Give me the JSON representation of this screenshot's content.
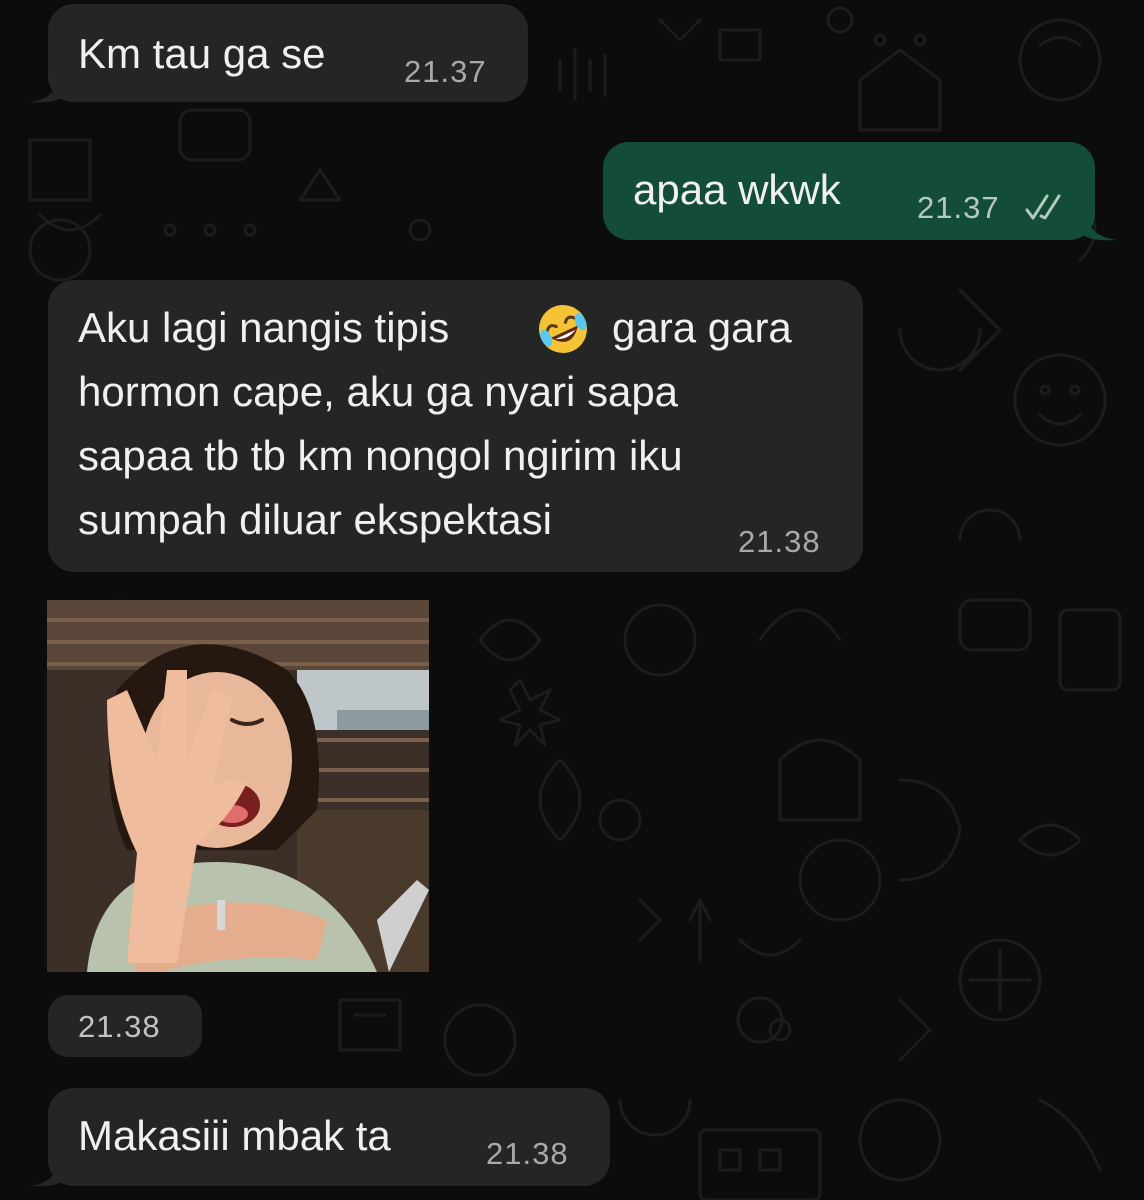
{
  "chat": {
    "messages": [
      {
        "id": "m1",
        "direction": "incoming",
        "text": "Km tau ga se",
        "time": "21.37"
      },
      {
        "id": "m2",
        "direction": "outgoing",
        "text": "apaa wkwk",
        "time": "21.37",
        "status": "read",
        "status_icon": "double-check-icon"
      },
      {
        "id": "m3",
        "direction": "incoming",
        "lines": [
          "Aku lagi nangis tipis",
          "gara gara",
          "hormon cape, aku ga nyari sapa",
          "sapaa tb tb km nongol ngirim iku",
          "sumpah diluar ekspektasi"
        ],
        "emoji": "🤣",
        "time": "21.38"
      },
      {
        "id": "m4",
        "direction": "incoming",
        "type": "image",
        "image_description_icon": "photo-girl-facepalm-laughing",
        "time": "21.38"
      },
      {
        "id": "m5",
        "direction": "incoming",
        "text": "Makasiii mbak ta",
        "time": "21.38"
      }
    ]
  },
  "colors": {
    "background": "#0c0c0c",
    "incoming_bubble": "#242626",
    "outgoing_bubble": "#144d37",
    "text": "#f0f0f0",
    "timestamp": "#a9a9a9"
  }
}
